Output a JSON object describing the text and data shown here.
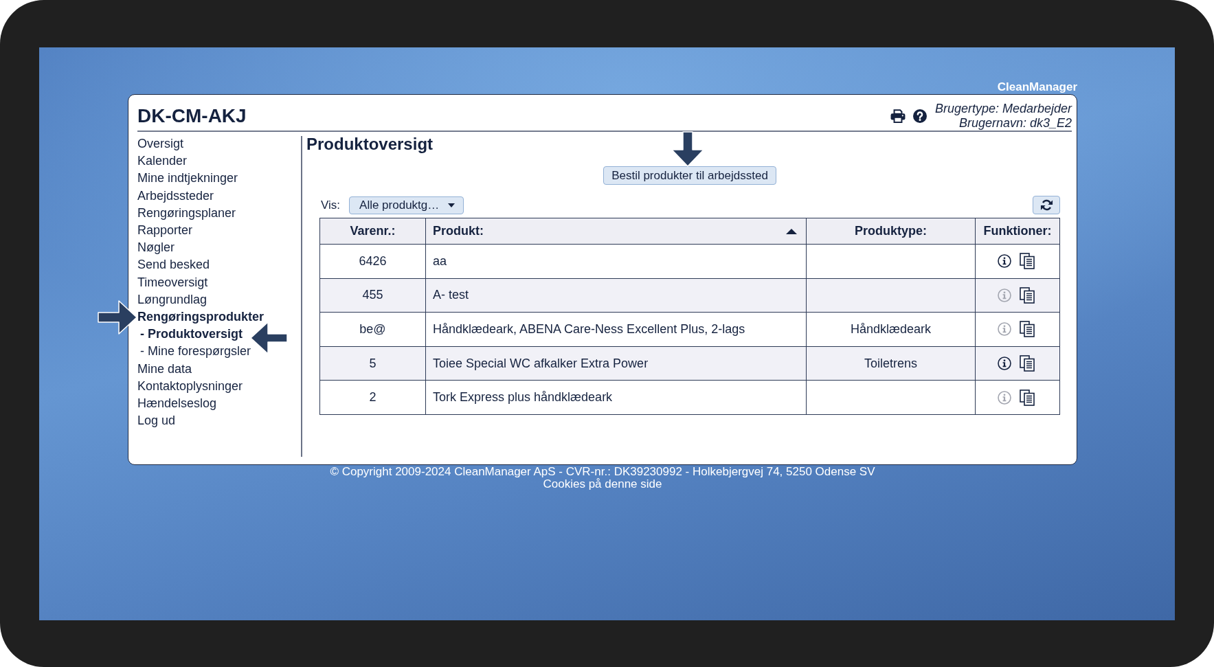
{
  "brand": "CleanManager",
  "header": {
    "title": "DK-CM-AKJ",
    "user_type": "Brugertype: Medarbejder",
    "user_name": "Brugernavn: dk3_E2"
  },
  "sidebar": {
    "items": [
      {
        "label": "Oversigt",
        "selected": false
      },
      {
        "label": "Kalender",
        "selected": false
      },
      {
        "label": "Mine indtjekninger",
        "selected": false
      },
      {
        "label": "Arbejdssteder",
        "selected": false
      },
      {
        "label": "Rengøringsplaner",
        "selected": false
      },
      {
        "label": "Rapporter",
        "selected": false
      },
      {
        "label": "Nøgler",
        "selected": false
      },
      {
        "label": "Send besked",
        "selected": false
      },
      {
        "label": "Timeoversigt",
        "selected": false
      },
      {
        "label": "Løngrundlag",
        "selected": false
      },
      {
        "label": "Rengøringsprodukter",
        "selected": true,
        "children": [
          {
            "label": "- Produktoversigt",
            "selected": true
          },
          {
            "label": "- Mine forespørgsler",
            "selected": false
          }
        ]
      },
      {
        "label": "Mine data",
        "selected": false
      },
      {
        "label": "Kontaktoplysninger",
        "selected": false
      },
      {
        "label": "Hændelseslog",
        "selected": false
      },
      {
        "label": "Log ud",
        "selected": false
      }
    ]
  },
  "page": {
    "title": "Produktoversigt",
    "order_button": "Bestil produkter til arbejdssted",
    "filter": {
      "label": "Vis:",
      "value": "Alle produktg…"
    }
  },
  "table": {
    "columns": [
      {
        "label": "Varenr.:",
        "sorted": false
      },
      {
        "label": "Produkt:",
        "sorted": true
      },
      {
        "label": "Produktype:",
        "sorted": false
      },
      {
        "label": "Funktioner:",
        "sorted": false
      }
    ],
    "rows": [
      {
        "item_no": "6426",
        "product": "aa",
        "info_enabled": true
      },
      {
        "item_no": "455",
        "product": "A- test",
        "info_enabled": false
      },
      {
        "item_no": "be@",
        "product": "Håndklædeark, ABENA Care-Ness Excellent Plus, 2-lags",
        "product_type": "Håndklædeark",
        "info_enabled": false
      },
      {
        "item_no": "5",
        "product": "Toiee Special WC afkalker Extra Power",
        "product_type": "Toiletrens",
        "info_enabled": true
      },
      {
        "item_no": "2",
        "product": "Tork Express plus håndklædeark",
        "info_enabled": false
      }
    ]
  },
  "footer": {
    "copyright": "© Copyright 2009-2024 CleanManager ApS - CVR-nr.: DK39230992 - Holkebjergvej 74, 5250 Odense SV",
    "cookies_link": "Cookies på denne side"
  }
}
